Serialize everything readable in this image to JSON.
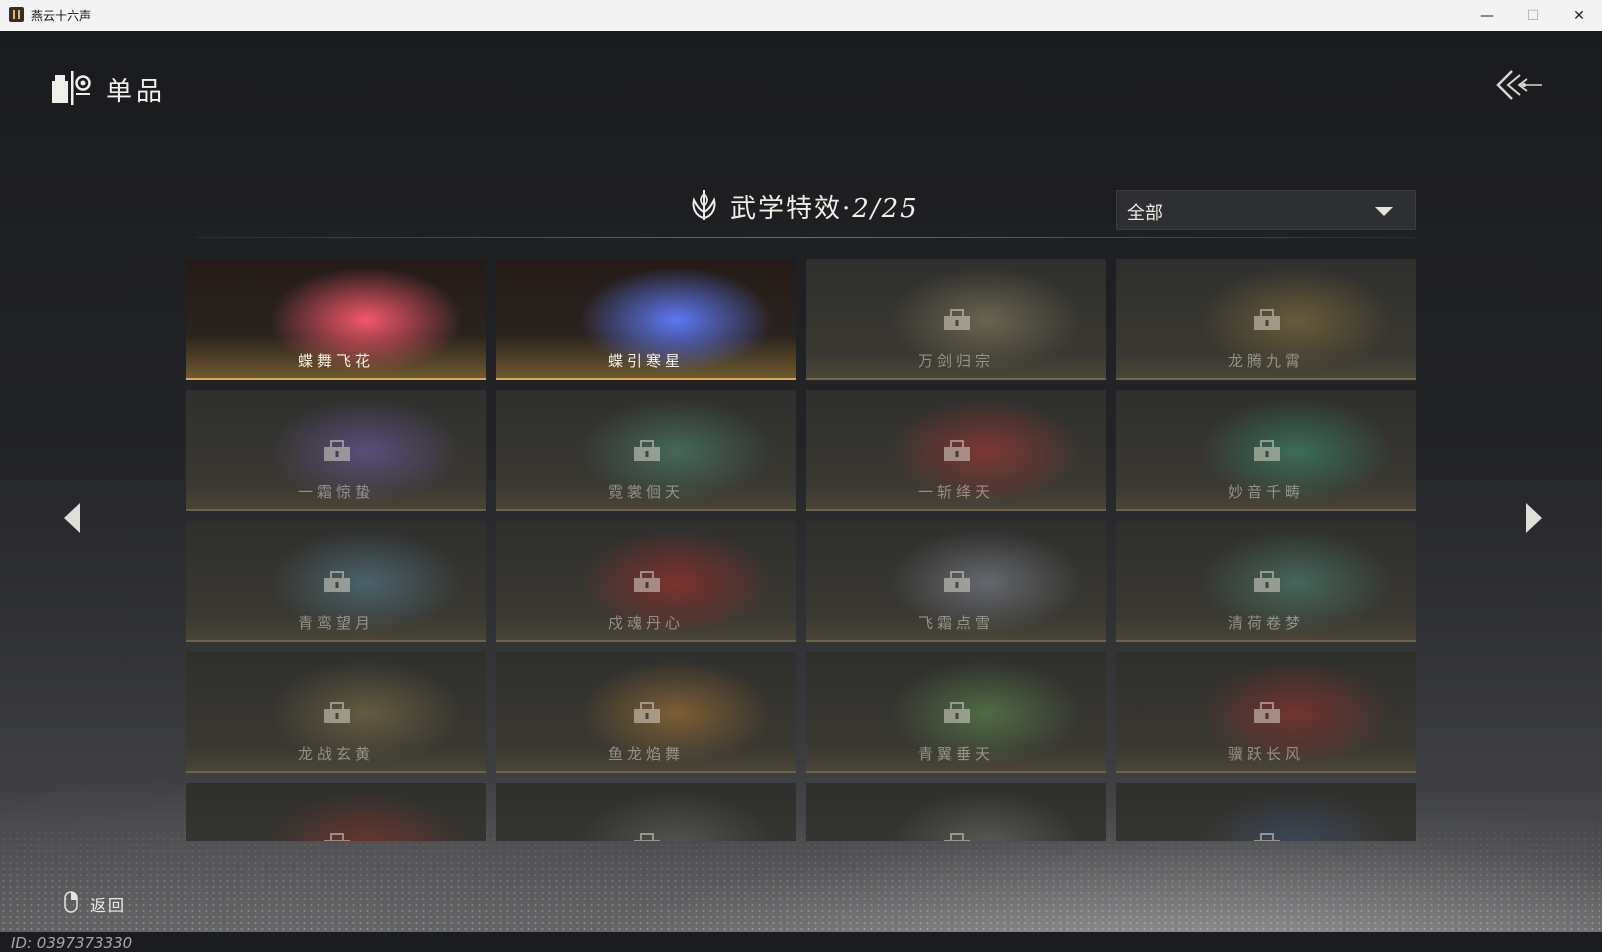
{
  "window": {
    "title": "燕云十六声",
    "minimize": "—",
    "maximize": "☐",
    "close": "✕"
  },
  "header": {
    "title": "单品",
    "icon": "shop-lantern-icon",
    "back_icon": "triple-chevron-back-icon"
  },
  "section": {
    "icon": "lotus-flame-icon",
    "title": "武学特效",
    "separator": "·",
    "count": "2/25"
  },
  "filter": {
    "selected": "全部"
  },
  "cards": [
    {
      "name": "蝶舞飞花",
      "unlocked": true,
      "color": "#ff5a6e"
    },
    {
      "name": "蝶引寒星",
      "unlocked": true,
      "color": "#5f7dff"
    },
    {
      "name": "万剑归宗",
      "unlocked": false,
      "color": "#c9b98a"
    },
    {
      "name": "龙腾九霄",
      "unlocked": false,
      "color": "#c9a24a"
    },
    {
      "name": "一霜惊蛰",
      "unlocked": false,
      "color": "#9a7cff"
    },
    {
      "name": "霓裳佪天",
      "unlocked": false,
      "color": "#5fc7a8"
    },
    {
      "name": "一斩绛天",
      "unlocked": false,
      "color": "#ff3b3b"
    },
    {
      "name": "妙音千畴",
      "unlocked": false,
      "color": "#3fd6a0"
    },
    {
      "name": "青鸾望月",
      "unlocked": false,
      "color": "#6fb6d8"
    },
    {
      "name": "戍魂丹心",
      "unlocked": false,
      "color": "#ff2a2a"
    },
    {
      "name": "飞霜点雪",
      "unlocked": false,
      "color": "#b9c6e0"
    },
    {
      "name": "清荷卷梦",
      "unlocked": false,
      "color": "#62c2a8"
    },
    {
      "name": "龙战玄黄",
      "unlocked": false,
      "color": "#b8a160"
    },
    {
      "name": "鱼龙焰舞",
      "unlocked": false,
      "color": "#ffab3a"
    },
    {
      "name": "青翼垂天",
      "unlocked": false,
      "color": "#7fcf6a"
    },
    {
      "name": "骥跃长风",
      "unlocked": false,
      "color": "#e0302e"
    },
    {
      "name": "",
      "unlocked": false,
      "color": "#c23a2e"
    },
    {
      "name": "",
      "unlocked": false,
      "color": "#8a8a8a"
    },
    {
      "name": "",
      "unlocked": false,
      "color": "#9a9a9a"
    },
    {
      "name": "",
      "unlocked": false,
      "color": "#4c6aa8"
    }
  ],
  "footer": {
    "back_label": "返回",
    "mouse_icon": "mouse-right-click-icon",
    "player_id": "ID: 0397373330"
  }
}
